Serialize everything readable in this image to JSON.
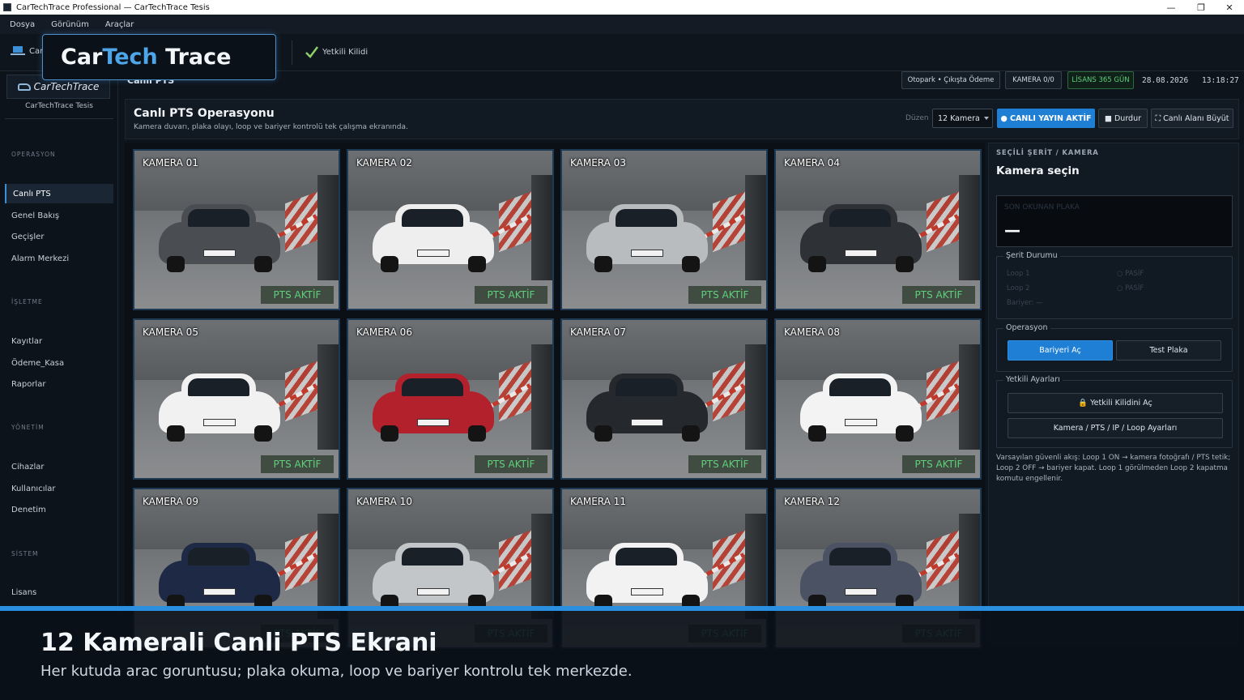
{
  "window": {
    "title": "CarTechTrace Professional — CarTechTrace Tesis",
    "minimize": "—",
    "restore": "❐",
    "close": "✕"
  },
  "menu": [
    "Dosya",
    "Görünüm",
    "Araçlar"
  ],
  "toolbar": {
    "live_label": "Canlı",
    "approve_label": "Yetkili Kilidi"
  },
  "logo_popup": {
    "part1": "Car",
    "part2": "Tech",
    "part3": "Trace"
  },
  "sidebar": {
    "logo_text": "CarTechTrace",
    "site_name": "CarTechTrace Tesis",
    "sections": [
      {
        "title": "OPERASYON",
        "items": [
          "Canlı PTS",
          "Genel Bakış",
          "Geçişler",
          "Alarm Merkezi"
        ]
      },
      {
        "title": "İŞLETME",
        "items": [
          "Kayıtlar",
          "Ödeme_Kasa",
          "Raporlar"
        ]
      },
      {
        "title": "YÖNETİM",
        "items": [
          "Cihazlar",
          "Kullanıcılar",
          "Denetim"
        ]
      },
      {
        "title": "SİSTEM",
        "items": [
          "Lisans"
        ]
      }
    ]
  },
  "header": {
    "breadcrumb": "Canlı PTS",
    "chip_payment": "Otopark • Çıkışta Ödeme",
    "chip_camera": "KAMERA 0/0",
    "chip_license": "LİSANS 365 GÜN",
    "date": "28.08.2026",
    "time": "13:18:27"
  },
  "panel": {
    "title": "Canlı PTS Operasyonu",
    "description": "Kamera duvarı, plaka olayı, loop ve bariyer kontrolü tek çalışma ekranında.",
    "layout_label": "Düzen",
    "camera_select": "12 Kamera",
    "live_button": "● CANLI YAYIN AKTİF",
    "stop_button": "■ Durdur",
    "expand_button": "⛶ Canlı Alanı Büyüt"
  },
  "cameras": [
    {
      "label": "KAMERA 01",
      "status": "PTS AKTİF",
      "color": "#4a4d52"
    },
    {
      "label": "KAMERA 02",
      "status": "PTS AKTİF",
      "color": "#eeeeee"
    },
    {
      "label": "KAMERA 03",
      "status": "PTS AKTİF",
      "color": "#b9bcbf"
    },
    {
      "label": "KAMERA 04",
      "status": "PTS AKTİF",
      "color": "#2e3136"
    },
    {
      "label": "KAMERA 05",
      "status": "PTS AKTİF",
      "color": "#f1f1f1"
    },
    {
      "label": "KAMERA 06",
      "status": "PTS AKTİF",
      "color": "#b3222c"
    },
    {
      "label": "KAMERA 07",
      "status": "PTS AKTİF",
      "color": "#25282c"
    },
    {
      "label": "KAMERA 08",
      "status": "PTS AKTİF",
      "color": "#f3f3f3"
    },
    {
      "label": "KAMERA 09",
      "status": "PTS AKTİF",
      "color": "#1e2a45"
    },
    {
      "label": "KAMERA 10",
      "status": "PTS AKTİF",
      "color": "#c3c6c9"
    },
    {
      "label": "KAMERA 11",
      "status": "PTS AKTİF",
      "color": "#f2f2f2"
    },
    {
      "label": "KAMERA 12",
      "status": "PTS AKTİF",
      "color": "#4a5264"
    }
  ],
  "right_panel": {
    "section": "SEÇİLİ ŞERİT / KAMERA",
    "title": "Kamera seçin",
    "last_plate_label": "SON OKUNAN PLAKA",
    "last_plate_value": "—",
    "lane_status_title": "Şerit Durumu",
    "loop1": "Loop 1",
    "loop1_state": "○ PASİF",
    "loop2": "Loop 2",
    "loop2_state": "○ PASİF",
    "barrier": "Bariyer: —",
    "operation_title": "Operasyon",
    "open_barrier": "Bariyeri Aç",
    "test_plate": "Test Plaka",
    "auth_title": "Yetkili Ayarları",
    "unlock": "🔒 Yetkili Kilidini Aç",
    "settings": "Kamera / PTS / IP / Loop Ayarları",
    "note": "Varsayılan güvenli akış: Loop 1 ON → kamera fotoğrafı / PTS tetik; Loop 2 OFF → bariyer kapat. Loop 1 görülmeden Loop 2 kapatma komutu engellenir."
  },
  "overlay": {
    "title": "12 Kamerali Canli PTS Ekrani",
    "subtitle": "Her kutuda arac goruntusu; plaka okuma, loop ve bariyer kontrolu tek merkezde."
  },
  "colors": {
    "accent": "#1f7fd4",
    "status_green": "#5fd07a",
    "background": "#0e141c"
  }
}
